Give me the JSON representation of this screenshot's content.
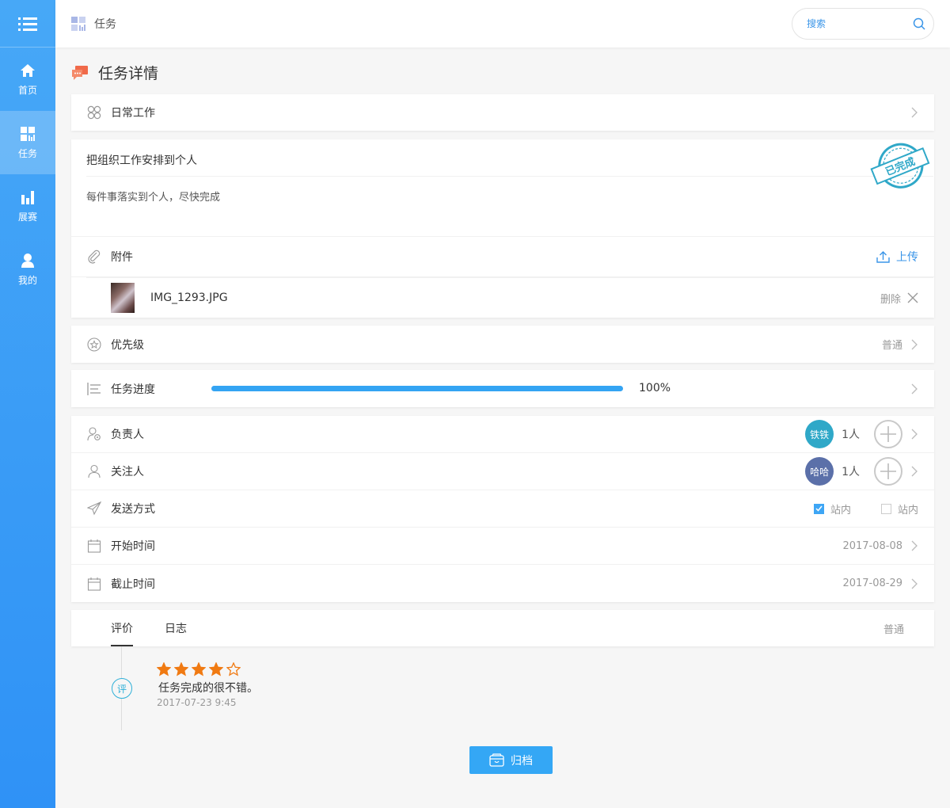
{
  "sidebar": {
    "items": [
      {
        "label": "首页",
        "icon": "home-icon"
      },
      {
        "label": "任务",
        "icon": "grid-icon",
        "active": true
      },
      {
        "label": "展赛",
        "icon": "bar-chart-icon"
      },
      {
        "label": "我的",
        "icon": "user-icon"
      }
    ]
  },
  "header": {
    "breadcrumb": "任务",
    "search_placeholder": "搜索"
  },
  "page": {
    "title": "任务详情"
  },
  "category": {
    "label": "日常工作"
  },
  "task": {
    "title": "把组织工作安排到个人",
    "description": "每件事落实到个人，尽快完成",
    "stamp": "已完成"
  },
  "attachment": {
    "label": "附件",
    "upload_label": "上传",
    "file_name": "IMG_1293.JPG",
    "delete_label": "删除"
  },
  "priority": {
    "label": "优先级",
    "value": "普通"
  },
  "progress": {
    "label": "任务进度",
    "value": 1.0,
    "text": "100%"
  },
  "people": {
    "owner": {
      "label": "负责人",
      "avatar": "铁铁",
      "count": "1人",
      "color": "#2fa8c8"
    },
    "follower": {
      "label": "关注人",
      "avatar": "哈哈",
      "count": "1人",
      "color": "#5b70a9"
    }
  },
  "send": {
    "label": "发送方式",
    "option1": "站内",
    "option1_checked": true,
    "option2": "站内",
    "option2_checked": false
  },
  "start": {
    "label": "开始时间",
    "value": "2017-08-08"
  },
  "end": {
    "label": "截止时间",
    "value": "2017-08-29"
  },
  "tabs": {
    "items": [
      "评价",
      "日志"
    ],
    "right_value": "普通"
  },
  "review": {
    "badge": "评",
    "rating": 4,
    "max_rating": 5,
    "text": "任务完成的很不错。",
    "time": "2017-07-23 9:45"
  },
  "archive_label": "归档",
  "colors": {
    "accent": "#34a7f5",
    "star": "#f07a12",
    "stamp": "#2fa8c8"
  }
}
